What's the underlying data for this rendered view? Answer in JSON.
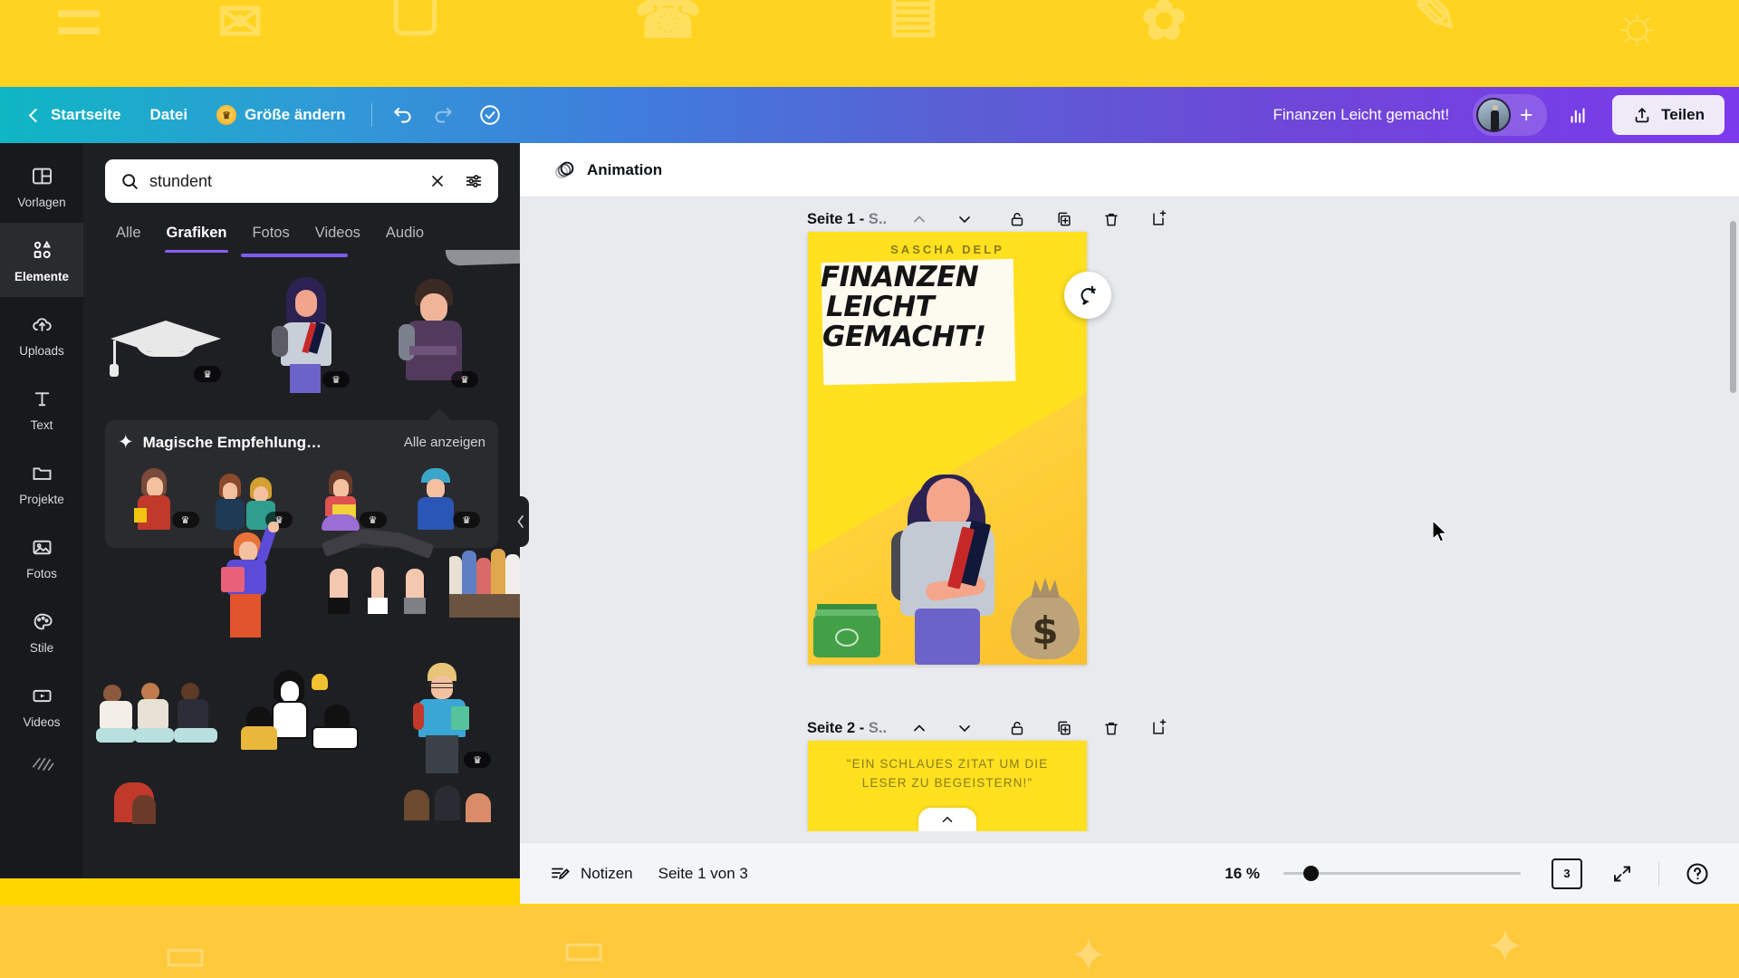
{
  "topbar": {
    "home_label": "Startseite",
    "file_label": "Datei",
    "resize_label": "Größe ändern",
    "undo_icon": "undo-icon",
    "redo_icon": "redo-icon",
    "cloud_saved_icon": "cloud-check-icon",
    "doc_title": "Finanzen Leicht gemacht!",
    "add_collaborator_label": "+",
    "insights_icon": "bar-chart-icon",
    "share_label": "Teilen",
    "share_icon": "upload-icon",
    "gradient_from": "#0fb6c4",
    "gradient_to": "#7c3aed"
  },
  "rail": {
    "items": [
      {
        "label": "Vorlagen",
        "icon": "templates-icon",
        "active": false
      },
      {
        "label": "Elemente",
        "icon": "elements-icon",
        "active": true
      },
      {
        "label": "Uploads",
        "icon": "upload-cloud-icon",
        "active": false
      },
      {
        "label": "Text",
        "icon": "text-icon",
        "active": false
      },
      {
        "label": "Projekte",
        "icon": "folder-icon",
        "active": false
      },
      {
        "label": "Fotos",
        "icon": "photo-icon",
        "active": false
      },
      {
        "label": "Stile",
        "icon": "palette-icon",
        "active": false
      },
      {
        "label": "Videos",
        "icon": "video-icon",
        "active": false
      },
      {
        "label": "",
        "icon": "background-icon",
        "active": false
      }
    ]
  },
  "search": {
    "value": "stundent",
    "placeholder": "Suchen",
    "search_icon": "search-icon",
    "clear_icon": "close-icon",
    "filter_icon": "filter-sliders-icon",
    "tabs": [
      {
        "label": "Alle",
        "active": false
      },
      {
        "label": "Grafiken",
        "active": true
      },
      {
        "label": "Fotos",
        "active": false
      },
      {
        "label": "Videos",
        "active": false
      },
      {
        "label": "Audio",
        "active": false
      }
    ],
    "accent": "#8b5cf6"
  },
  "magic": {
    "sparkle_icon": "sparkle-icon",
    "title": "Magische Empfehlung…",
    "see_all": "Alle anzeigen",
    "items": [
      {
        "name": "student-girl-books",
        "premium": true
      },
      {
        "name": "students-pair-studying",
        "premium": true
      },
      {
        "name": "student-girl-folder",
        "premium": true
      },
      {
        "name": "student-boy-cap",
        "premium": true
      }
    ]
  },
  "results": {
    "rows": [
      [
        {
          "name": "graduation-cap",
          "premium": true
        },
        {
          "name": "student-woman-books",
          "premium": true
        },
        {
          "name": "student-man-backpack",
          "premium": true
        }
      ],
      [
        {
          "name": "student-raising-hand",
          "premium": false
        },
        {
          "name": "graduation-caps-thrown",
          "premium": false
        },
        {
          "name": "student-crowd-group",
          "premium": true
        }
      ],
      [
        {
          "name": "students-sitting-group",
          "premium": false
        },
        {
          "name": "students-studying-idea",
          "premium": false
        },
        {
          "name": "student-boy-glasses",
          "premium": true
        }
      ]
    ],
    "collapse_icon": "chevron-left-icon"
  },
  "main": {
    "animation_label": "Animation",
    "animation_icon": "animation-icon",
    "comment_icon": "add-comment-icon"
  },
  "pages": [
    {
      "label_bold": "Seite 1 -",
      "label_dim": "S..",
      "up_icon": "chevron-up-icon",
      "down_icon": "chevron-down-icon",
      "lock_icon": "unlock-icon",
      "duplicate_icon": "duplicate-icon",
      "delete_icon": "trash-icon",
      "add_icon": "add-page-icon",
      "content": {
        "byline": "SASCHA DELP",
        "headline": [
          "FINANZEN",
          "LEICHT",
          "GEMACHT!"
        ]
      }
    },
    {
      "label_bold": "Seite 2 -",
      "label_dim": "S..",
      "up_icon": "chevron-up-icon",
      "down_icon": "chevron-down-icon",
      "lock_icon": "unlock-icon",
      "duplicate_icon": "duplicate-icon",
      "delete_icon": "trash-icon",
      "add_icon": "add-page-icon",
      "content": {
        "quote": "\"EIN SCHLAUES ZITAT UM DIE LESER ZU BEGEISTERN!\""
      }
    }
  ],
  "bottombar": {
    "notes_label": "Notizen",
    "notes_icon": "notes-icon",
    "page_indicator": "Seite 1 von 3",
    "zoom_percent": "16 %",
    "page_count": "3",
    "pages_icon": "pages-icon",
    "fullscreen_icon": "fullscreen-icon",
    "help_icon": "help-icon"
  }
}
